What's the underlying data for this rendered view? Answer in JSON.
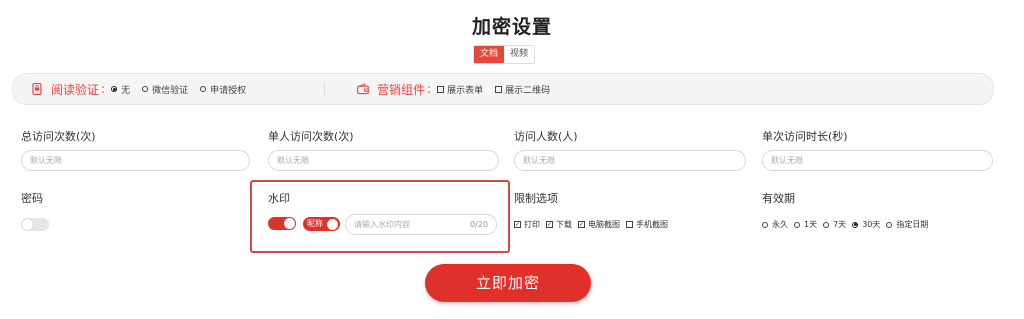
{
  "title": "加密设置",
  "tabs": [
    {
      "label": "文档",
      "active": true
    },
    {
      "label": "视频",
      "active": false
    }
  ],
  "settings_bar": {
    "read_verify": {
      "icon": "phone-lock-icon",
      "label": "阅读验证",
      "colon": ":",
      "options": [
        {
          "label": "无",
          "selected": true
        },
        {
          "label": "微信验证",
          "selected": false
        },
        {
          "label": "申请授权",
          "selected": false
        }
      ]
    },
    "marketing": {
      "icon": "wallet-icon",
      "label": "营销组件",
      "colon": ":",
      "options": [
        {
          "label": "展示表单",
          "checked": false
        },
        {
          "label": "展示二维码",
          "checked": false
        }
      ]
    }
  },
  "fields": {
    "total_visits": {
      "label": "总访问次数(次)",
      "placeholder": "默认无限"
    },
    "per_person_visits": {
      "label": "单人访问次数(次)",
      "placeholder": "默认无限"
    },
    "visitors": {
      "label": "访问人数(人)",
      "placeholder": "默认无限"
    },
    "visit_duration": {
      "label": "单次访问时长(秒)",
      "placeholder": "默认无限"
    }
  },
  "password": {
    "label": "密码",
    "enabled": false
  },
  "watermark": {
    "label": "水印",
    "enabled": true,
    "nickname_label": "昵称",
    "nickname_enabled": true,
    "placeholder": "请输入水印内容",
    "counter": "0/20"
  },
  "restrictions": {
    "label": "限制选项",
    "options": [
      {
        "label": "打印",
        "checked": true
      },
      {
        "label": "下载",
        "checked": true
      },
      {
        "label": "电脑截图",
        "checked": true
      },
      {
        "label": "手机截图",
        "checked": false
      }
    ]
  },
  "validity": {
    "label": "有效期",
    "options": [
      {
        "label": "永久",
        "selected": false
      },
      {
        "label": "1天",
        "selected": false
      },
      {
        "label": "7天",
        "selected": false
      },
      {
        "label": "30天",
        "selected": true
      },
      {
        "label": "指定日期",
        "selected": false
      }
    ]
  },
  "submit_label": "立即加密",
  "colors": {
    "accent": "#e0302a",
    "highlight_border": "#d9463d"
  }
}
